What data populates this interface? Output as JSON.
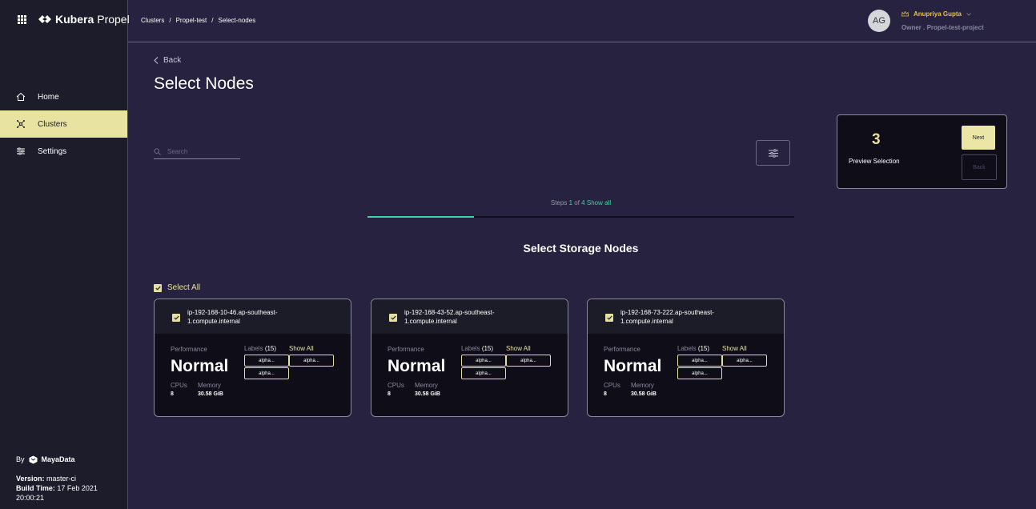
{
  "brand": {
    "name_bold": "Kubera",
    "name_light": "Propel"
  },
  "sidebar": {
    "items": [
      {
        "label": "Home",
        "icon": "home-icon"
      },
      {
        "label": "Clusters",
        "icon": "clusters-icon",
        "active": true
      },
      {
        "label": "Settings",
        "icon": "settings-sliders-icon"
      }
    ],
    "footer": {
      "by": "By",
      "company": "MayaData",
      "version_label": "Version:",
      "version": "master-ci",
      "build_label": "Build Time:",
      "build_time": "17 Feb 2021 20:00:21"
    }
  },
  "breadcrumb": [
    "Clusters",
    "/",
    "Propel-test",
    "/",
    "Select-nodes"
  ],
  "user": {
    "initials": "AG",
    "name": "Anupriya Gupta",
    "role": "Owner . Propel-test-project"
  },
  "page": {
    "back_label": "Back",
    "title": "Select Nodes"
  },
  "search": {
    "placeholder": "Search"
  },
  "preview": {
    "count": "3",
    "label": "Preview Selection",
    "next_label": "Next",
    "back_label": "Back"
  },
  "steps": {
    "prefix": "Steps",
    "current": "1",
    "of": "of",
    "total": "4",
    "show_all": "Show all",
    "progress": 0.25
  },
  "section_title": "Select Storage Nodes",
  "select_all_label": "Select All",
  "accent_color": "#3cd5a2",
  "highlight_color": "#e6e0a0",
  "nodes": [
    {
      "name": "ip-192-168-10-46.ap-southeast-1.compute.internal",
      "performance_label": "Performance",
      "performance": "Normal",
      "cpus_label": "CPUs",
      "cpus": "8",
      "memory_label": "Memory",
      "memory": "30.58 GiB",
      "labels_label": "Labels",
      "labels_count": "(15)",
      "show_all": "Show All",
      "chips": [
        "alpha...",
        "alpha...",
        "alpha..."
      ]
    },
    {
      "name": "ip-192-168-43-52.ap-southeast-1.compute.internal",
      "performance_label": "Performance",
      "performance": "Normal",
      "cpus_label": "CPUs",
      "cpus": "8",
      "memory_label": "Memory",
      "memory": "30.58 GiB",
      "labels_label": "Labels",
      "labels_count": "(15)",
      "show_all": "Show All",
      "chips": [
        "alpha...",
        "alpha...",
        "alpha..."
      ]
    },
    {
      "name": "ip-192-168-73-222.ap-southeast-1.compute.internal",
      "performance_label": "Performance",
      "performance": "Normal",
      "cpus_label": "CPUs",
      "cpus": "8",
      "memory_label": "Memory",
      "memory": "30.58 GiB",
      "labels_label": "Labels",
      "labels_count": "(15)",
      "show_all": "Show All",
      "chips": [
        "alpha...",
        "alpha...",
        "alpha..."
      ]
    }
  ]
}
